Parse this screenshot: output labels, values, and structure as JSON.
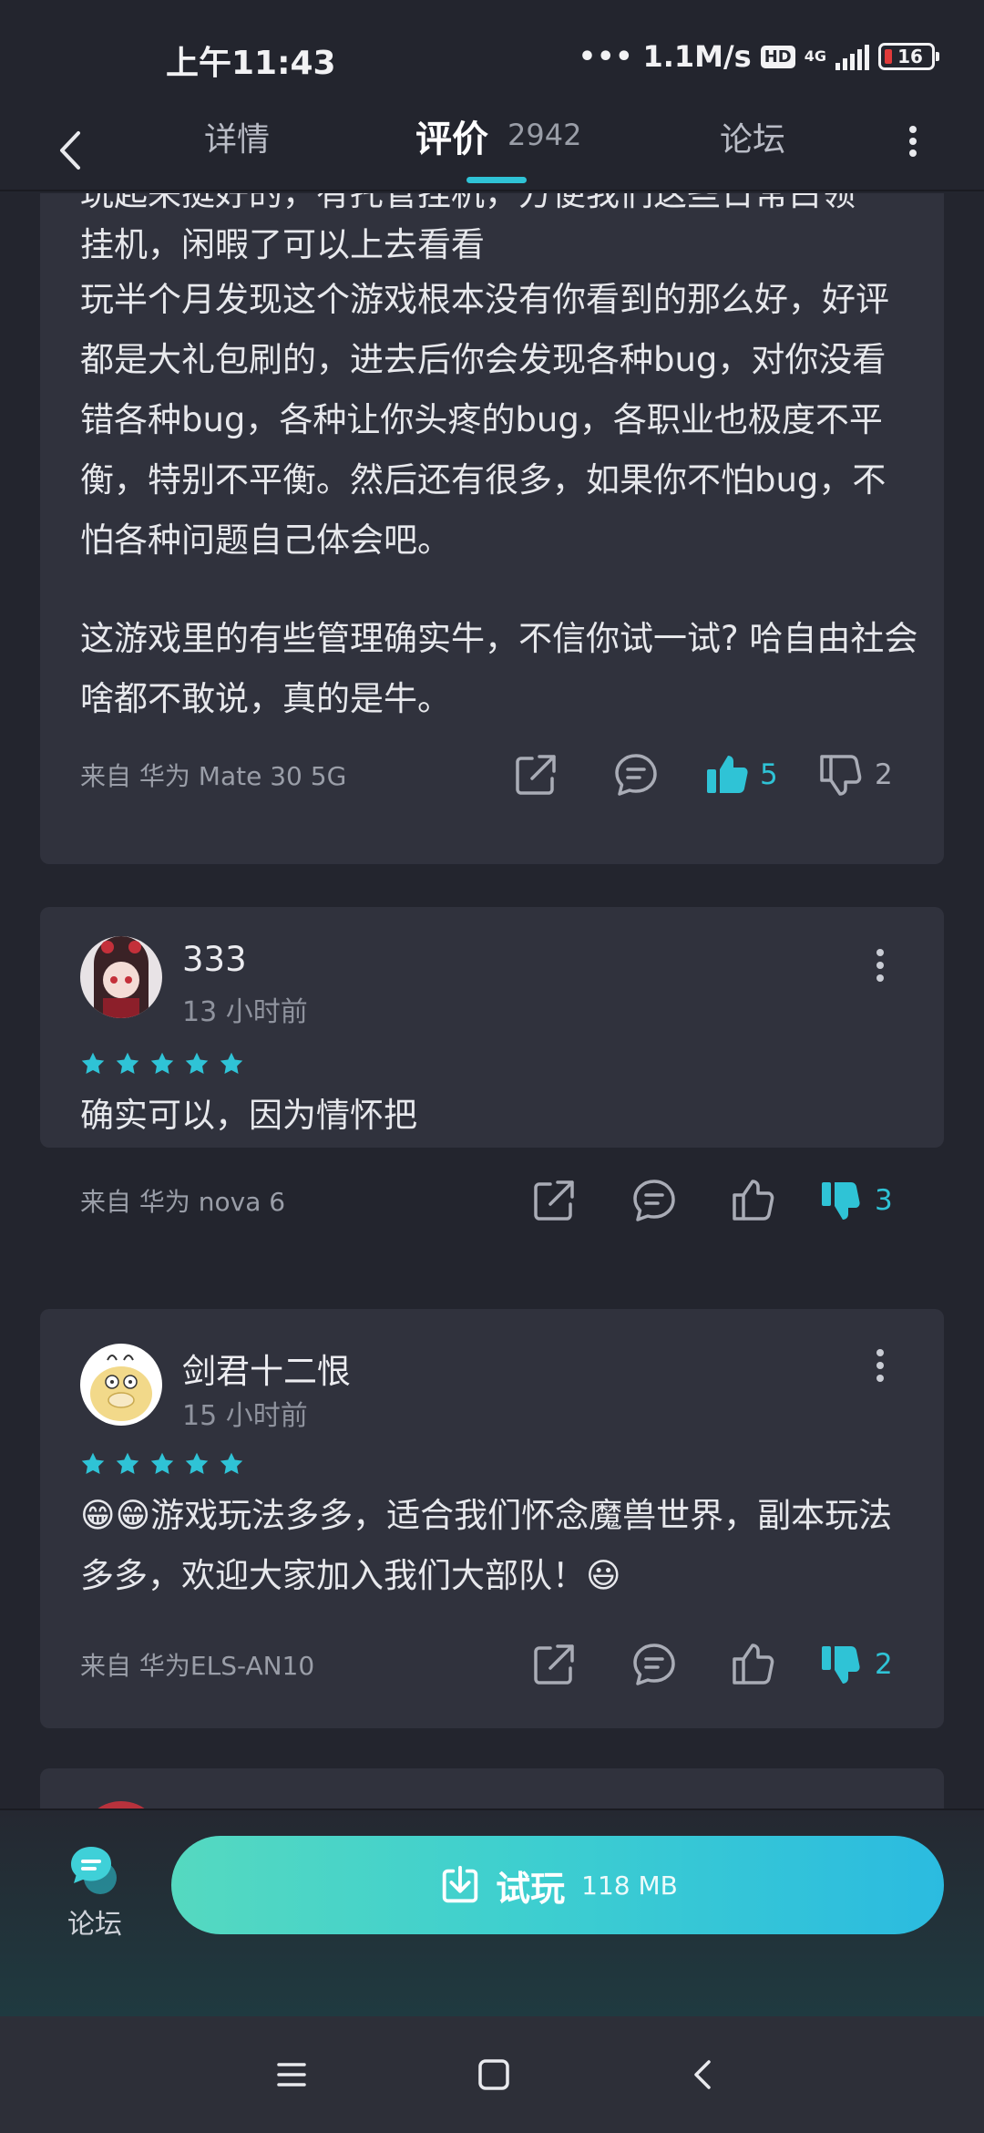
{
  "status_bar": {
    "time": "上午11:43",
    "speed": "1.1M/s",
    "hd": "HD",
    "network": "4G",
    "battery": "16"
  },
  "nav": {
    "tab_detail": "详情",
    "tab_reviews": "评价",
    "reviews_count": "2942",
    "tab_forum": "论坛"
  },
  "reviews": [
    {
      "paragraphs": [
        "玩起来挺好的，有托管挂机，方便我们这些日常白领",
        "挂机，闲暇了可以上去看看",
        "玩半个月发现这个游戏根本没有你看到的那么好，好评都是大礼包刷的，进去后你会发现各种bug，对你没看错各种bug，各种让你头疼的bug，各职业也极度不平衡，特别不平衡。然后还有很多，如果你不怕bug，不怕各种问题自己体会吧。",
        "这游戏里的有些管理确实牛，不信你试一试? 哈自由社会啥都不敢说，真的是牛。"
      ],
      "device": "来自 华为 Mate 30 5G",
      "likes": "5",
      "dislikes": "2"
    },
    {
      "user": "333",
      "time": "13 小时前",
      "rating": 5,
      "text": "确实可以，因为情怀把",
      "device": "来自 华为 nova 6",
      "dislikes": "3"
    },
    {
      "user": "剑君十二恨",
      "time": "15 小时前",
      "rating": 5,
      "text": "😁😁游戏玩法多多，适合我们怀念魔兽世界，副本玩法多多，欢迎大家加入我们大部队！😃",
      "device": "来自 华为ELS-AN10",
      "dislikes": "2"
    }
  ],
  "bottom": {
    "forum_label": "论坛",
    "trial_label": "试玩",
    "trial_size": "118 MB"
  },
  "colors": {
    "accent": "#2fc3d6",
    "card_bg": "#30323d",
    "page_bg": "#23252e"
  }
}
